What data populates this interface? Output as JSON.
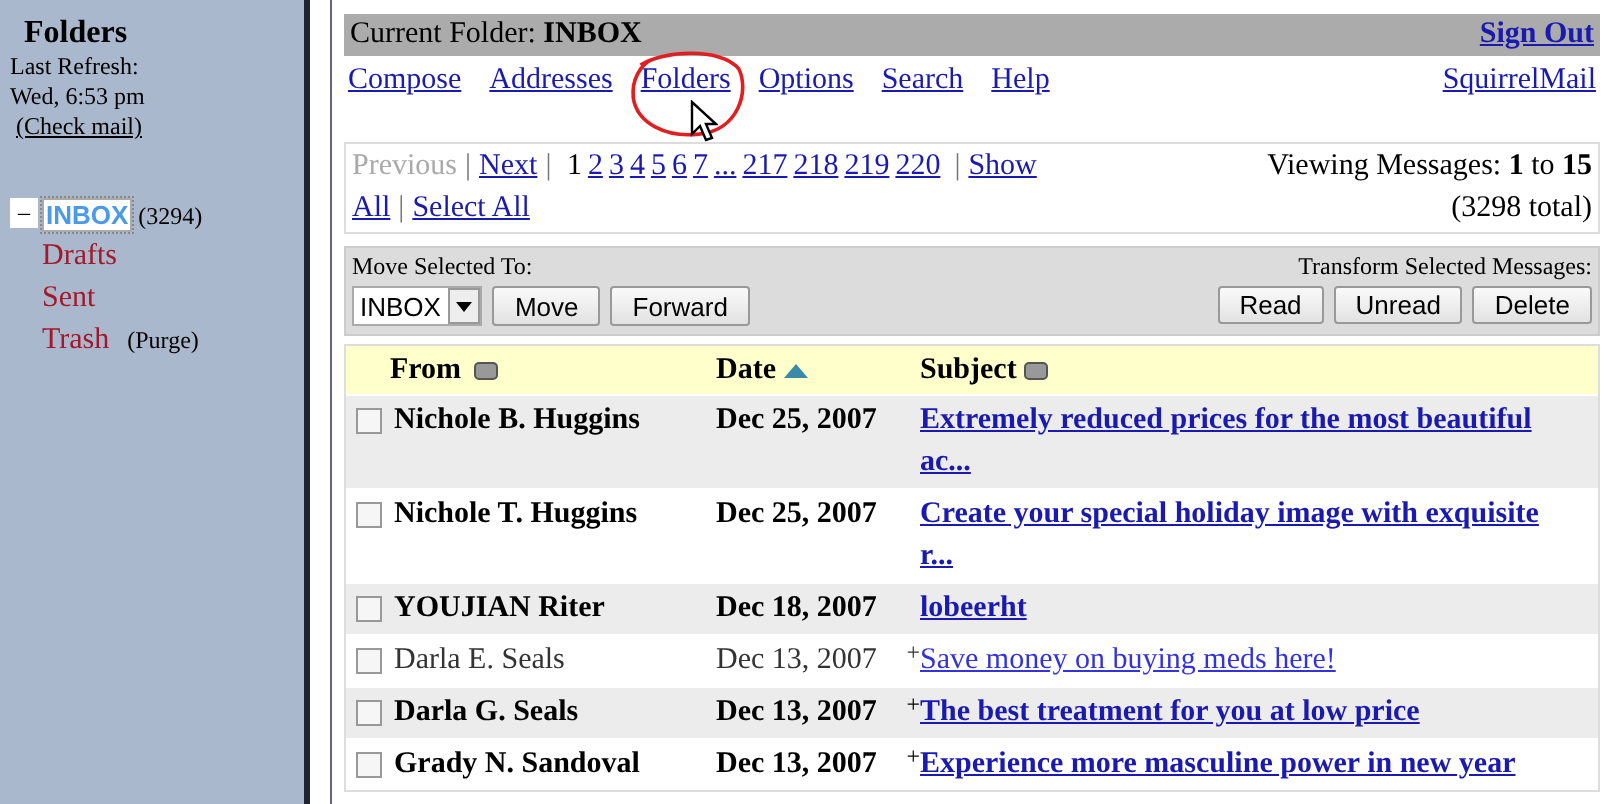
{
  "sidebar": {
    "title": "Folders",
    "refresh_label": "Last Refresh:",
    "refresh_time": "Wed, 6:53 pm",
    "check_mail": "(Check mail)",
    "collapse_toggle": "–",
    "folders": [
      {
        "name": "INBOX",
        "count": "(3294)",
        "selected": true
      },
      {
        "name": "Drafts",
        "selected": false
      },
      {
        "name": "Sent",
        "selected": false
      },
      {
        "name": "Trash",
        "action": "(Purge)",
        "selected": false
      }
    ]
  },
  "header": {
    "label": "Current Folder:",
    "folder": "INBOX",
    "sign_out": "Sign Out"
  },
  "nav": {
    "links": [
      {
        "label": "Compose",
        "circled": false
      },
      {
        "label": "Addresses",
        "circled": false
      },
      {
        "label": "Folders",
        "circled": true
      },
      {
        "label": "Options",
        "circled": false
      },
      {
        "label": "Search",
        "circled": false
      },
      {
        "label": "Help",
        "circled": false
      }
    ],
    "brand": "SquirrelMail"
  },
  "pager": {
    "separator": "|",
    "previous": "Previous",
    "next": "Next",
    "pages": [
      {
        "label": "1",
        "selected": true
      },
      {
        "label": "2",
        "selected": false
      },
      {
        "label": "3",
        "selected": false
      },
      {
        "label": "4",
        "selected": false
      },
      {
        "label": "5",
        "selected": false
      },
      {
        "label": "6",
        "selected": false
      },
      {
        "label": "7",
        "selected": false
      },
      {
        "label": "...",
        "selected": false
      },
      {
        "label": "217",
        "selected": false
      },
      {
        "label": "218",
        "selected": false
      },
      {
        "label": "219",
        "selected": false
      },
      {
        "label": "220",
        "selected": false
      }
    ],
    "show_all_1": "Show",
    "show_all_2": "All",
    "select_all": "Select All",
    "viewing_prefix": "Viewing Messages:",
    "from": "1",
    "to_word": "to",
    "to": "15",
    "total": "(3298 total)"
  },
  "actions": {
    "move_label": "Move Selected To:",
    "folder_select": "INBOX",
    "move": "Move",
    "forward": "Forward",
    "transform_label": "Transform Selected Messages:",
    "read": "Read",
    "unread": "Unread",
    "delete": "Delete"
  },
  "table": {
    "columns": [
      "From",
      "Date",
      "Subject"
    ],
    "rows": [
      {
        "from": "Nichole B. Huggins",
        "date": "Dec 25, 2007",
        "subject": "Extremely reduced prices for the most beautiful ac...",
        "unread": true,
        "checked": false
      },
      {
        "from": "Nichole T. Huggins",
        "date": "Dec 25, 2007",
        "subject": "Create your special holiday image with exquisite r...",
        "unread": true,
        "checked": false
      },
      {
        "from": "YOUJIAN Riter",
        "date": "Dec 18, 2007",
        "subject": "lobeerht",
        "unread": true,
        "checked": false
      },
      {
        "from": "Darla E. Seals",
        "date": "Dec 13, 2007",
        "mark": "+",
        "subject": "Save money on buying meds here!",
        "unread": false,
        "checked": false
      },
      {
        "from": "Darla G. Seals",
        "date": "Dec 13, 2007",
        "mark": "+",
        "subject": "The best treatment for you at low price",
        "unread": true,
        "checked": false
      },
      {
        "from": "Grady N. Sandoval",
        "date": "Dec 13, 2007",
        "mark": "+",
        "subject": "Experience more masculine power in new year",
        "unread": true,
        "checked": false
      }
    ]
  }
}
